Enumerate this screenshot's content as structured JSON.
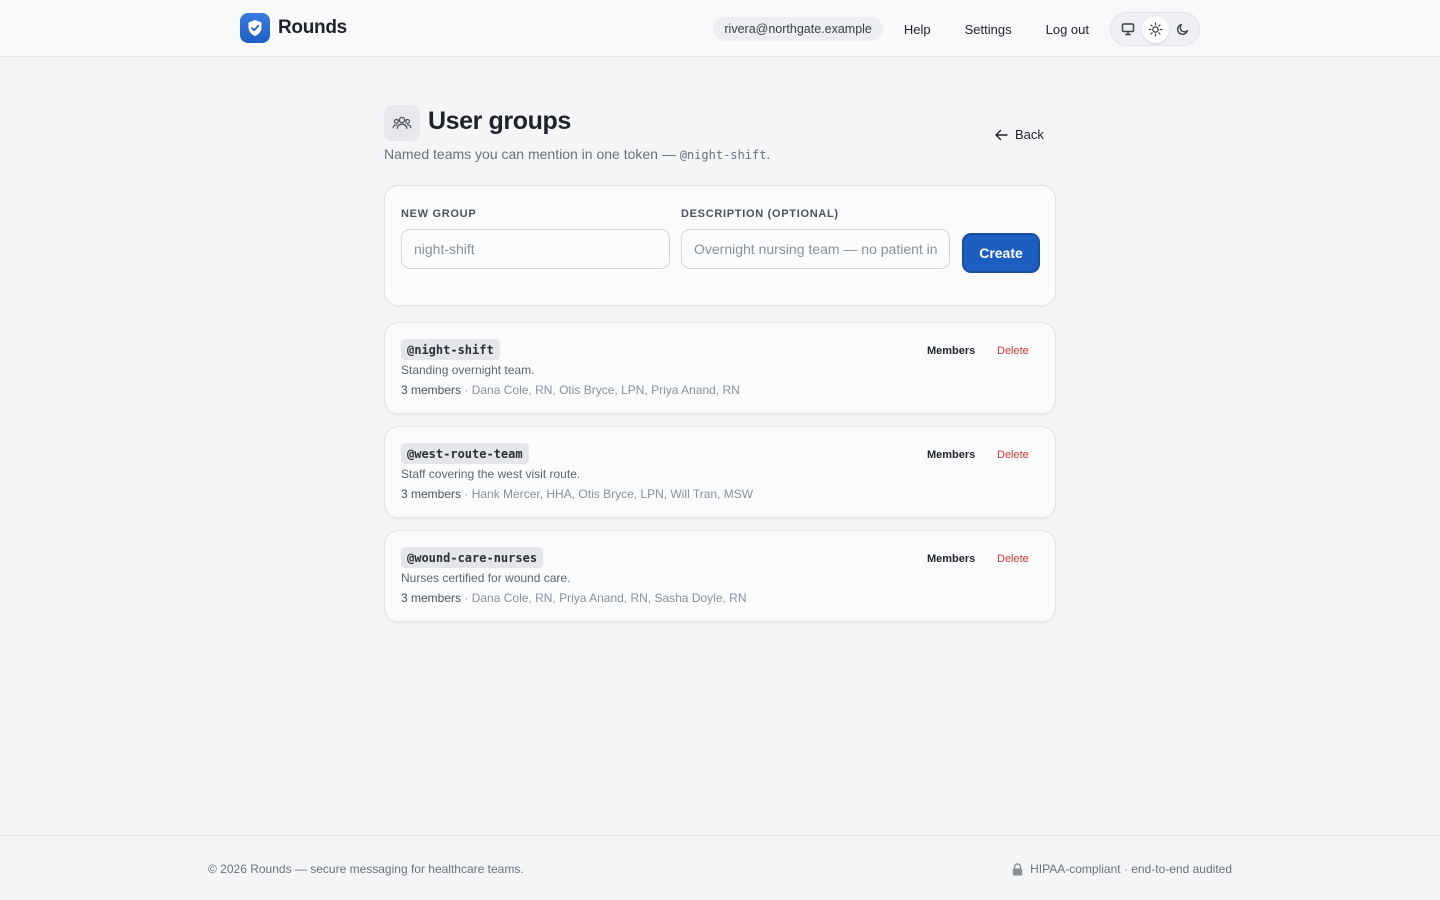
{
  "header": {
    "brand_name": "Rounds",
    "user_email": "rivera@northgate.example",
    "nav": [
      "Help",
      "Settings",
      "Log out"
    ],
    "theme_modes": [
      "monitor-icon",
      "sun-icon",
      "moon-icon"
    ],
    "active_theme": "light"
  },
  "page": {
    "title": "User groups",
    "subtitle_prefix": "Named teams you can mention in one token —",
    "subtitle_code": "@night-shift",
    "subtitle_suffix": ".",
    "back_label": "Back"
  },
  "form": {
    "group_label": "NEW GROUP",
    "group_placeholder": "night-shift",
    "description_label": "DESCRIPTION (OPTIONAL)",
    "description_placeholder": "Overnight nursing team — no patient info",
    "create_label": "Create"
  },
  "groups": [
    {
      "handle": "@night-shift",
      "description": "Standing overnight team.",
      "count": "3 members",
      "members": "· Dana Cole, RN, Otis Bryce, LPN, Priya Anand, RN",
      "members_label": "Members",
      "delete_label": "Delete"
    },
    {
      "handle": "@west-route-team",
      "description": "Staff covering the west visit route.",
      "count": "3 members",
      "members": "· Hank Mercer, HHA, Otis Bryce, LPN, Will Tran, MSW",
      "members_label": "Members",
      "delete_label": "Delete"
    },
    {
      "handle": "@wound-care-nurses",
      "description": "Nurses certified for wound care.",
      "count": "3 members",
      "members": "· Dana Cole, RN, Priya Anand, RN, Sasha Doyle, RN",
      "members_label": "Members",
      "delete_label": "Delete"
    }
  ],
  "footer": {
    "copyright": "© 2026 Rounds — secure messaging for healthcare teams.",
    "compliance": "HIPAA-compliant · end-to-end audited"
  },
  "colors": {
    "accent": "#1d5fc0",
    "danger": "#d23a3a",
    "background": "#f4f5f7"
  }
}
